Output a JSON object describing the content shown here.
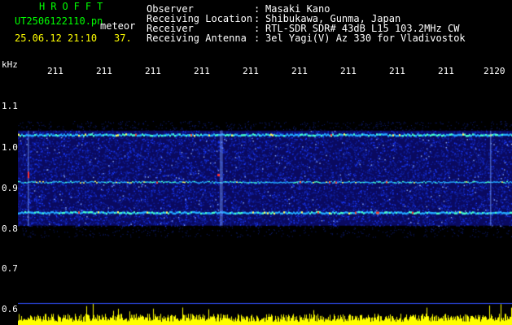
{
  "header": {
    "title": "HROFFT",
    "filename": "UT2506122110.pn",
    "meteor_label": "meteor",
    "datetime": "25.06.12 21:10",
    "counter": "37.",
    "info": [
      {
        "label": "Observer",
        "sep": ":",
        "value": "Masaki Kano"
      },
      {
        "label": "Receiving Location",
        "sep": ":",
        "value": "Shibukawa, Gunma, Japan"
      },
      {
        "label": "Receiver",
        "sep": ":",
        "value": "RTL-SDR SDR# 43dB L15 103.2MHz CW"
      },
      {
        "label": "Receiving Antenna",
        "sep": ":",
        "value": "3el Yagi(V) Az 330 for Vladivostok"
      }
    ]
  },
  "axes": {
    "y_unit": "kHz",
    "y_ticks": [
      "1.1",
      "1.0",
      "0.9",
      "0.8",
      "0.7",
      "0.6"
    ],
    "x_ticks": [
      "211",
      "211",
      "211",
      "211",
      "211",
      "211",
      "211",
      "211",
      "211",
      "2120"
    ]
  },
  "spectrogram": {
    "ymin_khz": 0.58,
    "ymax_khz": 1.15,
    "carrier_lines_khz": [
      1.02,
      0.91,
      0.84
    ],
    "background_color": "#0a0a60",
    "noise_color": "#1a3aff",
    "line_color": "#44ffcc",
    "peak_color": "#ff3030",
    "level_bar_color": "#ffff00"
  }
}
